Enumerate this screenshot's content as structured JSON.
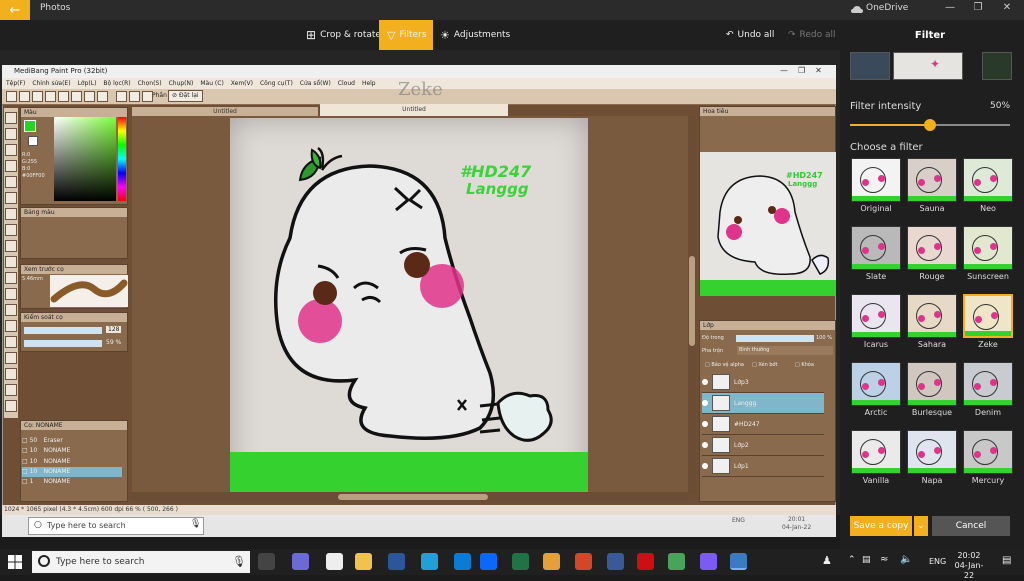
{
  "photos": {
    "app_title": "Photos",
    "onedrive_label": "OneDrive",
    "toolbar": {
      "crop_rotate": "Crop & rotate",
      "filters": "Filters",
      "adjustments": "Adjustments",
      "undo_all": "Undo all",
      "redo_all": "Redo all"
    },
    "accent": "#f2b01e"
  },
  "medibang": {
    "window_title": "MediBang Paint Pro (32bit)",
    "menu": [
      "Tệp(F)",
      "Chỉnh sửa(E)",
      "Lớp(L)",
      "Bộ lọc(R)",
      "Chọn(S)",
      "Chụp(N)",
      "Màu (C)",
      "Xem(V)",
      "Công cụ(T)",
      "Cửa sổ(W)",
      "Cloud",
      "Help"
    ],
    "toolbar_extra": "Đặt lại",
    "toolbar_phan": "Phần",
    "watermark": "Zeke",
    "doc_tabs": [
      "Untitled",
      "Untitled"
    ],
    "panels": {
      "color": "Màu",
      "color_values": [
        "R:0",
        "G:255",
        "B:0",
        "#00FF00"
      ],
      "palette": "Bảng màu",
      "brush_preview": "Xem trước cọ",
      "brush_size_label": "5.46mm",
      "brush_control": "Kiểm soát cọ",
      "brush_size": "128",
      "brush_opacity": "59 %",
      "brush_list_header": "Cọ: NONAME",
      "brushes": [
        {
          "size": "50",
          "name": "Eraser"
        },
        {
          "size": "10",
          "name": "NONAME"
        },
        {
          "size": "10",
          "name": "NONAME"
        },
        {
          "size": "10",
          "name": "NONAME"
        },
        {
          "size": "1",
          "name": "NONAME"
        }
      ],
      "navigator": "Hoa tiêu",
      "layers": "Lớp",
      "opacity_label": "Độ trong",
      "opacity_value": "100 %",
      "blend_label": "Pha trộn",
      "blend_value": "Bình thường",
      "protect_alpha": "Bảo vệ alpha",
      "clipping": "Xén bớt",
      "lock": "Khóa",
      "layer_items": [
        "Lớp3",
        "Langgg",
        "#HD247",
        "Lớp2",
        "Lớp1"
      ]
    },
    "canvas_text_1": "#HD247",
    "canvas_text_2": "Langgg",
    "status": "1024 * 1065 pixel  (4.3 * 4.5cm)  600 dpi  66 %  ( 500, 266 )"
  },
  "inner_taskbar": {
    "search_placeholder": "Type here to search",
    "clock": "20:01",
    "date": "04-Jan-22",
    "lang": "ENG"
  },
  "filter_pane": {
    "title": "Filter",
    "intensity_label": "Filter intensity",
    "intensity_value": "50%",
    "intensity_fraction": 0.5,
    "choose_label": "Choose a filter",
    "filters": [
      "Original",
      "Sauna",
      "Neo",
      "Slate",
      "Rouge",
      "Sunscreen",
      "Icarus",
      "Sahara",
      "Zeke",
      "Arctic",
      "Burlesque",
      "Denim",
      "Vanilla",
      "Napa",
      "Mercury"
    ],
    "selected": "Zeke",
    "save_label": "Save a copy",
    "cancel_label": "Cancel"
  },
  "taskbar": {
    "search_placeholder": "Type here to search",
    "lang": "ENG",
    "time": "20:02",
    "date": "04-Jan-22"
  }
}
